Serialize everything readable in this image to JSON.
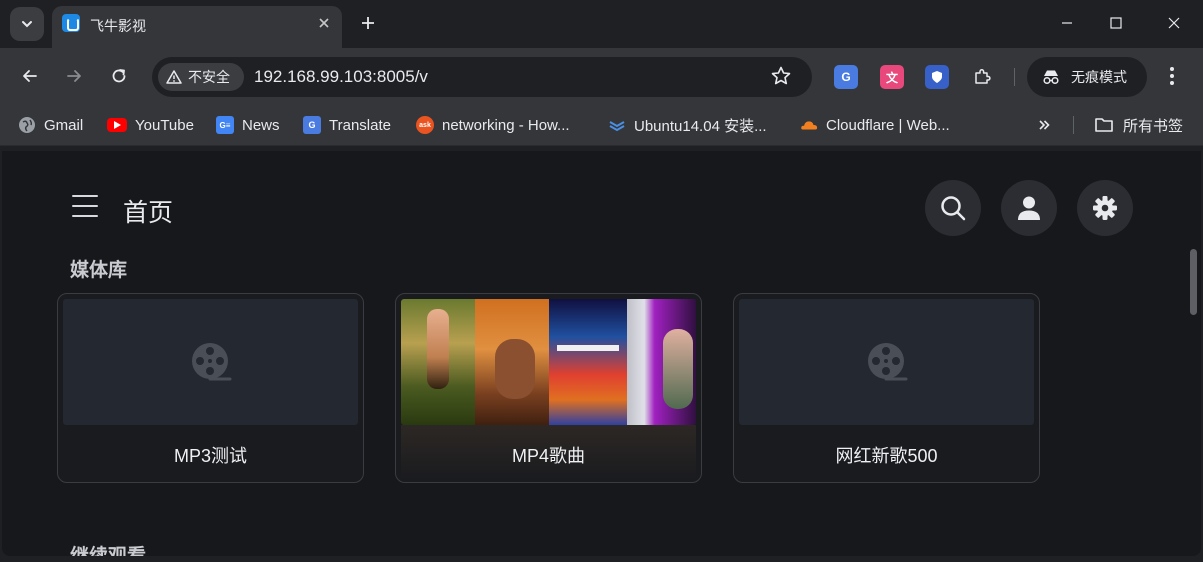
{
  "browser": {
    "tab": {
      "title": "飞牛影视"
    },
    "address": {
      "security_label": "不安全",
      "url": "192.168.99.103:8005/v"
    },
    "incognito_label": "无痕模式",
    "extensions": [
      "google-translate-icon",
      "language-icon",
      "shield-icon",
      "puzzle-icon"
    ],
    "bookmarks": [
      {
        "label": "Gmail",
        "icon": "globe-icon"
      },
      {
        "label": "YouTube",
        "icon": "youtube-icon",
        "color": "#ff0000"
      },
      {
        "label": "News",
        "icon": "google-news-icon",
        "color": "#4285f4"
      },
      {
        "label": "Translate",
        "icon": "google-translate-icon",
        "color": "#4285f4"
      },
      {
        "label": "networking - How...",
        "icon": "askubuntu-icon",
        "color": "#e95420"
      },
      {
        "label": "Ubuntu14.04 安装...",
        "icon": "layers-icon",
        "color": "#4a90e2"
      },
      {
        "label": "Cloudflare | Web...",
        "icon": "cloudflare-icon",
        "color": "#f38020"
      }
    ],
    "all_bookmarks_label": "所有书签"
  },
  "app": {
    "page_title": "首页",
    "media_library_title": "媒体库",
    "continue_watching_title": "继续观看",
    "libraries": [
      {
        "name": "MP3测试",
        "thumbnail": "film-reel-icon"
      },
      {
        "name": "MP4歌曲",
        "thumbnail": "video-mosaic"
      },
      {
        "name": "网红新歌500",
        "thumbnail": "film-reel-icon"
      }
    ]
  },
  "colors": {
    "page_bg": "#17181b",
    "card_bg": "#1a1b1f",
    "thumb_bg": "#242830",
    "chrome_toolbar": "#35363a",
    "chrome_frame": "#1f2023"
  }
}
